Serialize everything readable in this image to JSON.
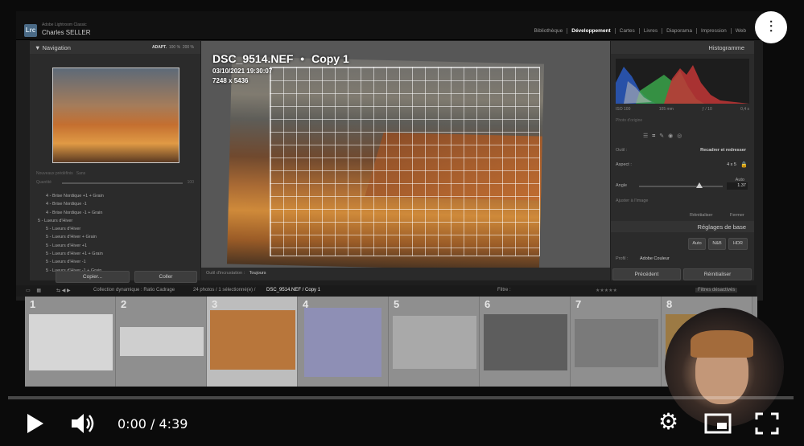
{
  "app": {
    "logo": "Lrc",
    "name": "Adobe Lightroom Classic",
    "user": "Charles SELLER"
  },
  "modules": [
    "Bibliothèque",
    "Développement",
    "Cartes",
    "Livres",
    "Diaporama",
    "Impression",
    "Web"
  ],
  "active_module": "Développement",
  "navigator": {
    "title": "Navigation",
    "zoom_options": [
      "ADAPT.",
      "100 %",
      "200 %"
    ]
  },
  "presets_head": {
    "label1": "Nouveaux prédéfinis",
    "label2": "Sans",
    "label3": "Quantité",
    "max": "100"
  },
  "presets": [
    "4 - Brise Nordique +1 + Grain",
    "4 - Brise Nordique -1",
    "4 - Brise Nordique -1 + Grain",
    "5 - Lueurs d'Hiver",
    "5 - Lueurs d'Hiver",
    "5 - Lueurs d'Hiver + Grain",
    "5 - Lueurs d'Hiver +1",
    "5 - Lueurs d'Hiver +1 + Grain",
    "5 - Lueurs d'Hiver -1",
    "5 - Lueurs d'Hiver -1 + Grain"
  ],
  "left_buttons": {
    "copy": "Copier...",
    "paste": "Coller"
  },
  "photo": {
    "filename": "DSC_9514.NEF",
    "separator": "•",
    "copy": "Copy 1",
    "date": "03/10/2021 19:30:07",
    "size": "7248 x 5436"
  },
  "center_toolbar": {
    "label": "Outil d'incrustation :",
    "value": "Toujours"
  },
  "histogram": {
    "title": "Histogramme",
    "iso": "ISO 100",
    "focal": "105 mm",
    "aperture": "ƒ / 10",
    "shutter": "0,4 s",
    "original": "Photo d'origine"
  },
  "crop": {
    "tool_label": "Outil :",
    "tool_title": "Recadrer et redresser",
    "aspect_label": "Aspect :",
    "aspect_value": "4 x 5",
    "auto_label": "Auto",
    "angle_label": "Angle",
    "angle_value": "1.37",
    "angle_fraction": 0.72,
    "fit_label": "Ajuster à l'image",
    "reset": "Réinitialiser",
    "close": "Fermer"
  },
  "basic": {
    "title": "Réglages de base",
    "auto": "Auto",
    "bw": "N&B",
    "hdr": "HDR",
    "profile_label": "Profil :",
    "profile_value": "Adobe Couleur"
  },
  "right_buttons": {
    "prev": "Précédent",
    "reset": "Réinitialiser"
  },
  "filmstrip_bar": {
    "collection": "Collection dynamique : Ratio Cadrage",
    "count": "24 photos / 1 sélectionné(e) /",
    "file": "DSC_9514.NEF / Copy 1",
    "filter_label": "Filtre :",
    "filter_value": "Filtres désactivés"
  },
  "thumbs": [
    {
      "num": "1",
      "tone": "#d6d6d6"
    },
    {
      "num": "2",
      "tone": "#cfcfcf"
    },
    {
      "num": "3",
      "tone": "#b8763b"
    },
    {
      "num": "4",
      "tone": "#8e8fb5"
    },
    {
      "num": "5",
      "tone": "#a9a9a9"
    },
    {
      "num": "6",
      "tone": "#5d5d5d"
    },
    {
      "num": "7",
      "tone": "#7a7a7a"
    },
    {
      "num": "8",
      "tone": "#9c7a44"
    }
  ],
  "player": {
    "time": "0:00 / 4:39",
    "progress": 0
  }
}
